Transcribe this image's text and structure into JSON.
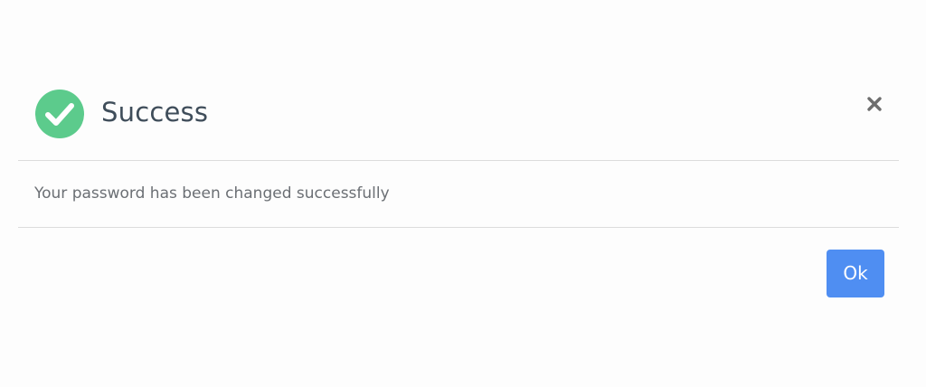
{
  "dialog": {
    "title": "Success",
    "message": "Your password has been changed successfully",
    "ok_label": "Ok",
    "icons": {
      "status": "check-circle-icon",
      "close": "close-icon"
    },
    "colors": {
      "success": "#5ccb8c",
      "title_text": "#3f4d5a",
      "message_text": "#6b6f74",
      "button": "#4f8ef2",
      "close_icon": "#6e6e6e"
    }
  }
}
